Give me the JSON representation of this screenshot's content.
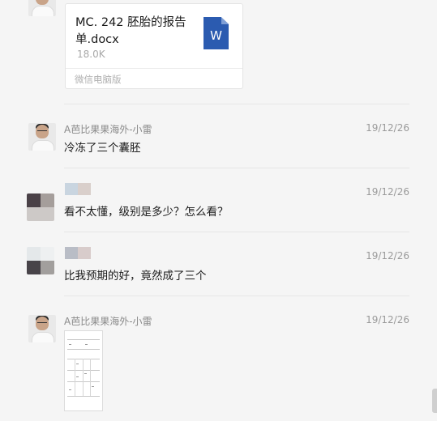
{
  "file_message": {
    "file_name": "MC. 242 胚胎的报告单.docx",
    "file_size": "18.0K",
    "file_type_icon": "word-doc-icon",
    "icon_letter": "W",
    "source": "微信电脑版"
  },
  "messages": [
    {
      "sender": "A芭比果果海外-小雷",
      "time": "19/12/26",
      "text": "冷冻了三个囊胚"
    },
    {
      "sender": "",
      "time": "19/12/26",
      "text": "看不太懂，级别是多少？怎么看？"
    },
    {
      "sender": "",
      "time": "19/12/26",
      "text": "比我预期的好，竟然成了三个"
    },
    {
      "sender": "A芭比果果海外-小雷",
      "time": "19/12/26",
      "text": ""
    }
  ],
  "colors": {
    "background": "#f5f5f5",
    "word_icon": "#2b5bb0",
    "meta_text": "#9a9a9a"
  }
}
